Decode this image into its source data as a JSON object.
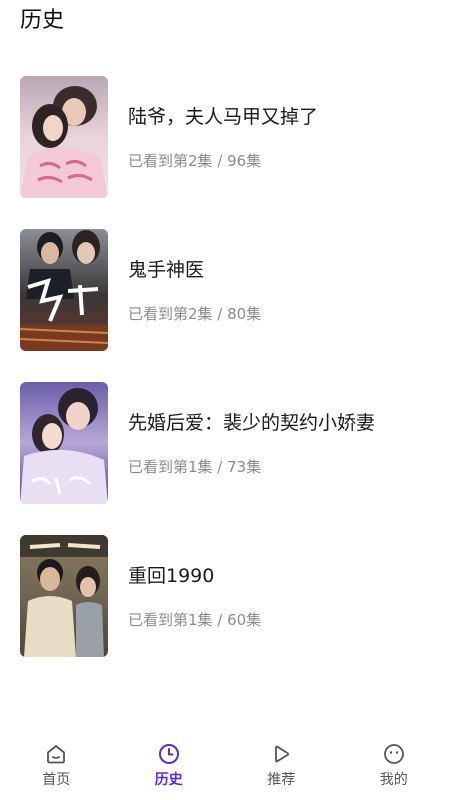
{
  "header": {
    "title": "历史"
  },
  "history": [
    {
      "title": "陆爷，夫人马甲又掉了",
      "progress": "已看到第2集 / 96集"
    },
    {
      "title": "鬼手神医",
      "progress": "已看到第2集 / 80集"
    },
    {
      "title": "先婚后爱：裴少的契约小娇妻",
      "progress": "已看到第1集 / 73集"
    },
    {
      "title": "重回1990",
      "progress": "已看到第1集 / 60集"
    }
  ],
  "tabs": [
    {
      "label": "首页",
      "icon": "home-icon",
      "active": false
    },
    {
      "label": "历史",
      "icon": "clock-icon",
      "active": true
    },
    {
      "label": "推荐",
      "icon": "play-icon",
      "active": false
    },
    {
      "label": "我的",
      "icon": "smiley-icon",
      "active": false
    }
  ],
  "colors": {
    "accent": "#5b2ad0",
    "inactive_tab": "#555555",
    "meta_text": "#8c8c8c"
  }
}
